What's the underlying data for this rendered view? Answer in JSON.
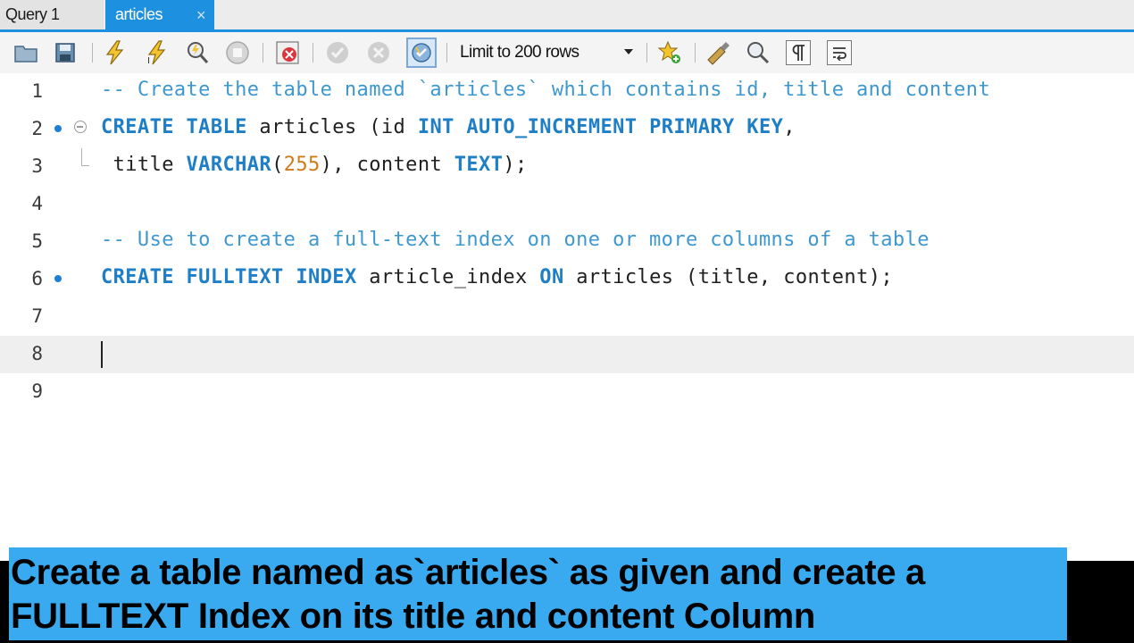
{
  "tabs": [
    {
      "label": "Query 1",
      "active": false
    },
    {
      "label": "articles",
      "active": true,
      "close_icon": "×"
    }
  ],
  "toolbar": {
    "icons": [
      "open-folder-icon",
      "save-icon",
      "execute-icon",
      "execute-current-icon",
      "explain-icon",
      "stop-icon",
      "toggle-error-icon",
      "commit-icon",
      "rollback-icon",
      "autocommit-icon",
      "bookmark-add-icon",
      "beautify-icon",
      "find-icon",
      "invisible-chars-icon",
      "word-wrap-icon"
    ],
    "limit_label": "Limit to 200 rows"
  },
  "editor": {
    "lines": [
      {
        "num": "1",
        "text": "-- Create the table named `articles` which contains id, title and content"
      },
      {
        "num": "2",
        "parts": [
          "CREATE",
          "TABLE",
          "articles (id ",
          "INT",
          "AUTO_INCREMENT",
          "PRIMARY",
          "KEY",
          ","
        ]
      },
      {
        "num": "3",
        "parts": [
          " title ",
          "VARCHAR",
          "(",
          "255",
          "), content ",
          "TEXT",
          ");"
        ]
      },
      {
        "num": "4"
      },
      {
        "num": "5",
        "text": "-- Use to create a full-text index on one or more columns of a table"
      },
      {
        "num": "6",
        "parts": [
          "CREATE",
          "FULLTEXT",
          "INDEX",
          "article_index ",
          "ON",
          " articles (title, content);"
        ]
      },
      {
        "num": "7"
      },
      {
        "num": "8"
      },
      {
        "num": "9"
      }
    ]
  },
  "caption": {
    "line1": "Create a table named as`articles` as given and create a",
    "line2": "FULLTEXT Index on its title and content Column"
  },
  "colors": {
    "keyword": "#1f7fc6",
    "comment": "#3e98d0",
    "number": "#d07a18",
    "accent": "#1e90e0",
    "caption_bg": "#39aaf0"
  }
}
